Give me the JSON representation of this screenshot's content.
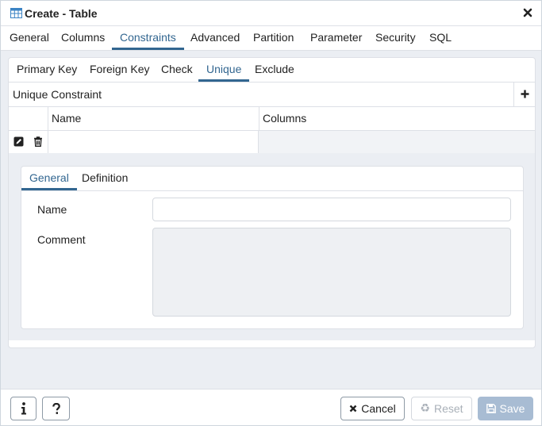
{
  "window": {
    "title": "Create - Table"
  },
  "main_tabs": [
    {
      "label": "General"
    },
    {
      "label": "Columns"
    },
    {
      "label": "Constraints",
      "active": true
    },
    {
      "label": "Advanced"
    },
    {
      "label": "Partition"
    },
    {
      "label": "Parameter"
    },
    {
      "label": "Security"
    },
    {
      "label": "SQL"
    }
  ],
  "constraint_tabs": [
    {
      "label": "Primary Key"
    },
    {
      "label": "Foreign Key"
    },
    {
      "label": "Check"
    },
    {
      "label": "Unique",
      "active": true
    },
    {
      "label": "Exclude"
    }
  ],
  "unique_constraint": {
    "title": "Unique Constraint",
    "columns": [
      "Name",
      "Columns"
    ],
    "rows": [
      {
        "name": "",
        "columns": ""
      }
    ]
  },
  "detail": {
    "tabs": [
      {
        "label": "General",
        "active": true
      },
      {
        "label": "Definition"
      }
    ],
    "fields": {
      "name_label": "Name",
      "name_value": "",
      "comment_label": "Comment",
      "comment_value": ""
    }
  },
  "footer": {
    "cancel": "Cancel",
    "reset": "Reset",
    "save": "Save"
  },
  "icons": {
    "title": "table-icon",
    "close": "close-icon",
    "info": "info-icon",
    "help": "help-icon",
    "add": "plus-icon",
    "edit": "edit-icon",
    "delete": "trash-icon",
    "cancel": "x-icon",
    "reset": "recycle-icon",
    "save": "floppy-disk-icon"
  },
  "colors": {
    "accent": "#326690",
    "primary_disabled": "#a8bcd3",
    "panel_bg": "#ebeef3"
  }
}
